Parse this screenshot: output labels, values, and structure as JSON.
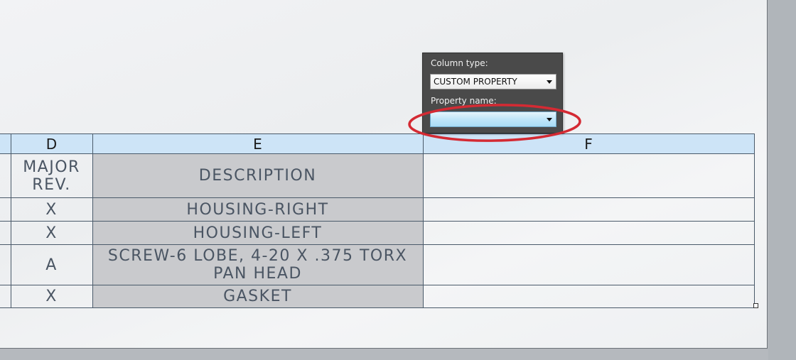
{
  "popup": {
    "column_type_label": "Column type:",
    "column_type_value": "CUSTOM PROPERTY",
    "property_name_label": "Property name:",
    "property_name_value": ""
  },
  "table": {
    "column_headers": [
      "",
      "D",
      "E",
      "F"
    ],
    "rows": [
      {
        "d_line1": "MAJOR",
        "d_line2": "REV.",
        "e_line1": "DESCRIPTION",
        "e_line2": "",
        "f": ""
      },
      {
        "d": "X",
        "e": "HOUSING-RIGHT",
        "f": ""
      },
      {
        "d": "X",
        "e": "HOUSING-LEFT",
        "f": ""
      },
      {
        "d": "A",
        "e_line1": "SCREW-6 LOBE, 4-20 X .375 TORX",
        "e_line2": "PAN HEAD",
        "f": ""
      },
      {
        "d": "X",
        "e": "GASKET",
        "f": ""
      }
    ]
  },
  "colors": {
    "header_bg": "#cde4f7",
    "description_col_bg": "#c9cacd",
    "highlight": "#d42a33",
    "popup_bg": "#4a4a4a"
  }
}
